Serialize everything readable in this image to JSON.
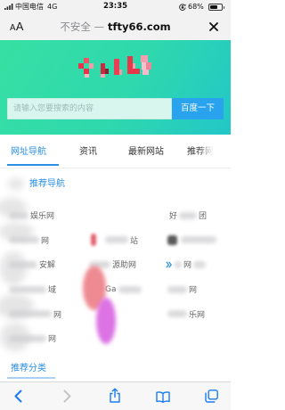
{
  "theme": {
    "accent": "#2b8fe3",
    "search_button": "#2aa3ee",
    "header_gradient": [
      "#36e0a3",
      "#22c7c8"
    ],
    "ios_blue": "#1a7cf5"
  },
  "status_bar": {
    "carrier": "中国电信",
    "network": "4G",
    "time": "23:35",
    "battery_percent": "68%",
    "battery_level": 0.68,
    "icons": [
      "signal-bars-icon",
      "orientation-lock-icon",
      "battery-icon"
    ]
  },
  "address_bar": {
    "reader_label": "AA",
    "security_label": "不安全 —",
    "domain": "tfty66.com",
    "close_icon": "close-icon"
  },
  "header": {
    "logo_icon": "pixelated-site-logo"
  },
  "search": {
    "placeholder": "请输入您要搜索的内容",
    "button_label": "百度一下"
  },
  "tabs": [
    {
      "label": "网址导航",
      "active": true
    },
    {
      "label": "资讯",
      "active": false
    },
    {
      "label": "最新网站",
      "active": false
    },
    {
      "label": "推荐网",
      "active": false
    }
  ],
  "recommended_nav": {
    "title": "推荐导航",
    "items": [
      {
        "text": "娱乐网"
      },
      {
        "text": "好",
        "tail": "团"
      },
      {
        "text": "网"
      },
      {
        "text": "站"
      },
      {
        "text": "安解"
      },
      {
        "text": "源助网"
      },
      {
        "text": "网"
      },
      {
        "text": "域"
      },
      {
        "text": "Ga"
      },
      {
        "text": "网"
      },
      {
        "text": "网"
      },
      {
        "text": "乐网"
      },
      {
        "text": "网"
      }
    ]
  },
  "recommended_categories": {
    "title": "推荐分类"
  },
  "toolbar": {
    "icons": [
      "back-chevron-icon",
      "forward-chevron-icon",
      "share-icon",
      "bookmarks-icon",
      "tabs-icon"
    ],
    "forward_enabled": false
  }
}
